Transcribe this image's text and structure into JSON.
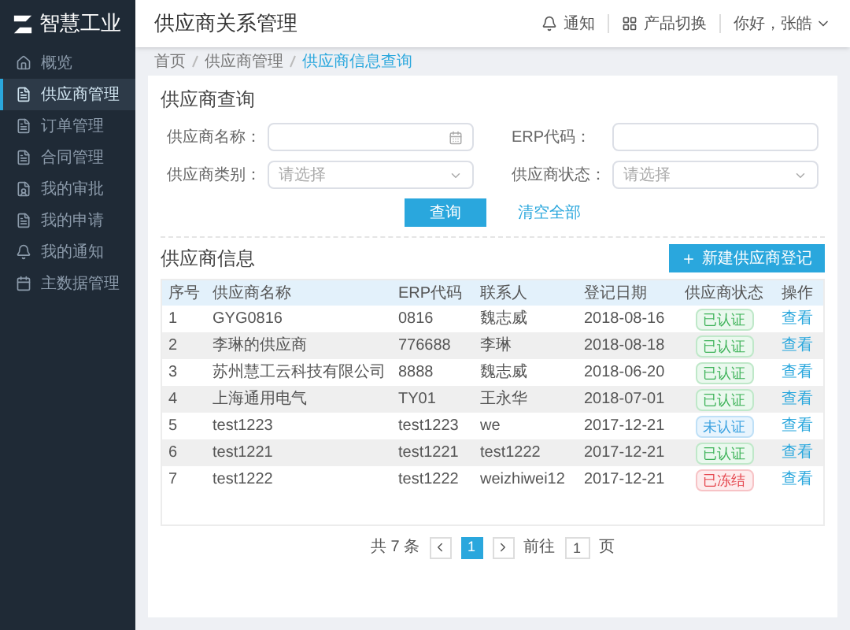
{
  "brand": {
    "name": "智慧工业"
  },
  "sidebar": {
    "items": [
      {
        "label": "概览",
        "selected": false
      },
      {
        "label": "供应商管理",
        "selected": true
      },
      {
        "label": "订单管理",
        "selected": false
      },
      {
        "label": "合同管理",
        "selected": false
      },
      {
        "label": "我的审批",
        "selected": false
      },
      {
        "label": "我的申请",
        "selected": false
      },
      {
        "label": "我的通知",
        "selected": false
      },
      {
        "label": "主数据管理",
        "selected": false
      }
    ]
  },
  "header": {
    "title": "供应商关系管理",
    "notify": "通知",
    "switch": "产品切换",
    "user": "你好，张皓"
  },
  "breadcrumb": [
    {
      "label": "首页",
      "selected": false
    },
    {
      "label": "供应商管理",
      "selected": false
    },
    {
      "label": "供应商信息查询",
      "selected": true
    }
  ],
  "query": {
    "title": "供应商查询",
    "fields": [
      {
        "label": "供应商名称：",
        "kind": "input"
      },
      {
        "label": "ERP代码：",
        "kind": "text"
      },
      {
        "label": "供应商类别：",
        "kind": "select",
        "placeholder": "请选择"
      },
      {
        "label": "供应商状态：",
        "kind": "select",
        "placeholder": "请选择"
      }
    ],
    "search_button": "查询",
    "clear_link": "清空全部"
  },
  "table": {
    "title": "供应商信息",
    "new_button": "新建供应商登记",
    "columns": [
      "序号",
      "供应商名称",
      "ERP代码",
      "联系人",
      "登记日期",
      "供应商状态",
      "操作"
    ],
    "rows": [
      {
        "no": "1",
        "name": "GYG0816",
        "erp": "0816",
        "contact": "魏志威",
        "date": "2018-08-16",
        "status": "已认证",
        "kind": "verified",
        "action": "查看"
      },
      {
        "no": "2",
        "name": "李琳的供应商",
        "erp": "776688",
        "contact": "李琳",
        "date": "2018-08-18",
        "status": "已认证",
        "kind": "verified",
        "action": "查看"
      },
      {
        "no": "3",
        "name": "苏州慧工云科技有限公司",
        "erp": "8888",
        "contact": "魏志威",
        "date": "2018-06-20",
        "status": "已认证",
        "kind": "verified",
        "action": "查看"
      },
      {
        "no": "4",
        "name": "上海通用电气",
        "erp": "TY01",
        "contact": "王永华",
        "date": "2018-07-01",
        "status": "已认证",
        "kind": "verified",
        "action": "查看"
      },
      {
        "no": "5",
        "name": "test1223",
        "erp": "test1223",
        "contact": "we",
        "date": "2017-12-21",
        "status": "未认证",
        "kind": "unverified",
        "action": "查看"
      },
      {
        "no": "6",
        "name": "test1221",
        "erp": "test1221",
        "contact": "test1222",
        "date": "2017-12-21",
        "status": "已认证",
        "kind": "verified",
        "action": "查看"
      },
      {
        "no": "7",
        "name": "test1222",
        "erp": "test1222",
        "contact": "weizhiwei12",
        "date": "2017-12-21",
        "status": "已冻结",
        "kind": "frozen",
        "action": "查看"
      }
    ]
  },
  "pagination": {
    "total": "共 7 条",
    "pages": [
      {
        "label": "1",
        "selected": true
      }
    ],
    "goto": "前往",
    "page_value": "1",
    "page_unit": "页"
  }
}
